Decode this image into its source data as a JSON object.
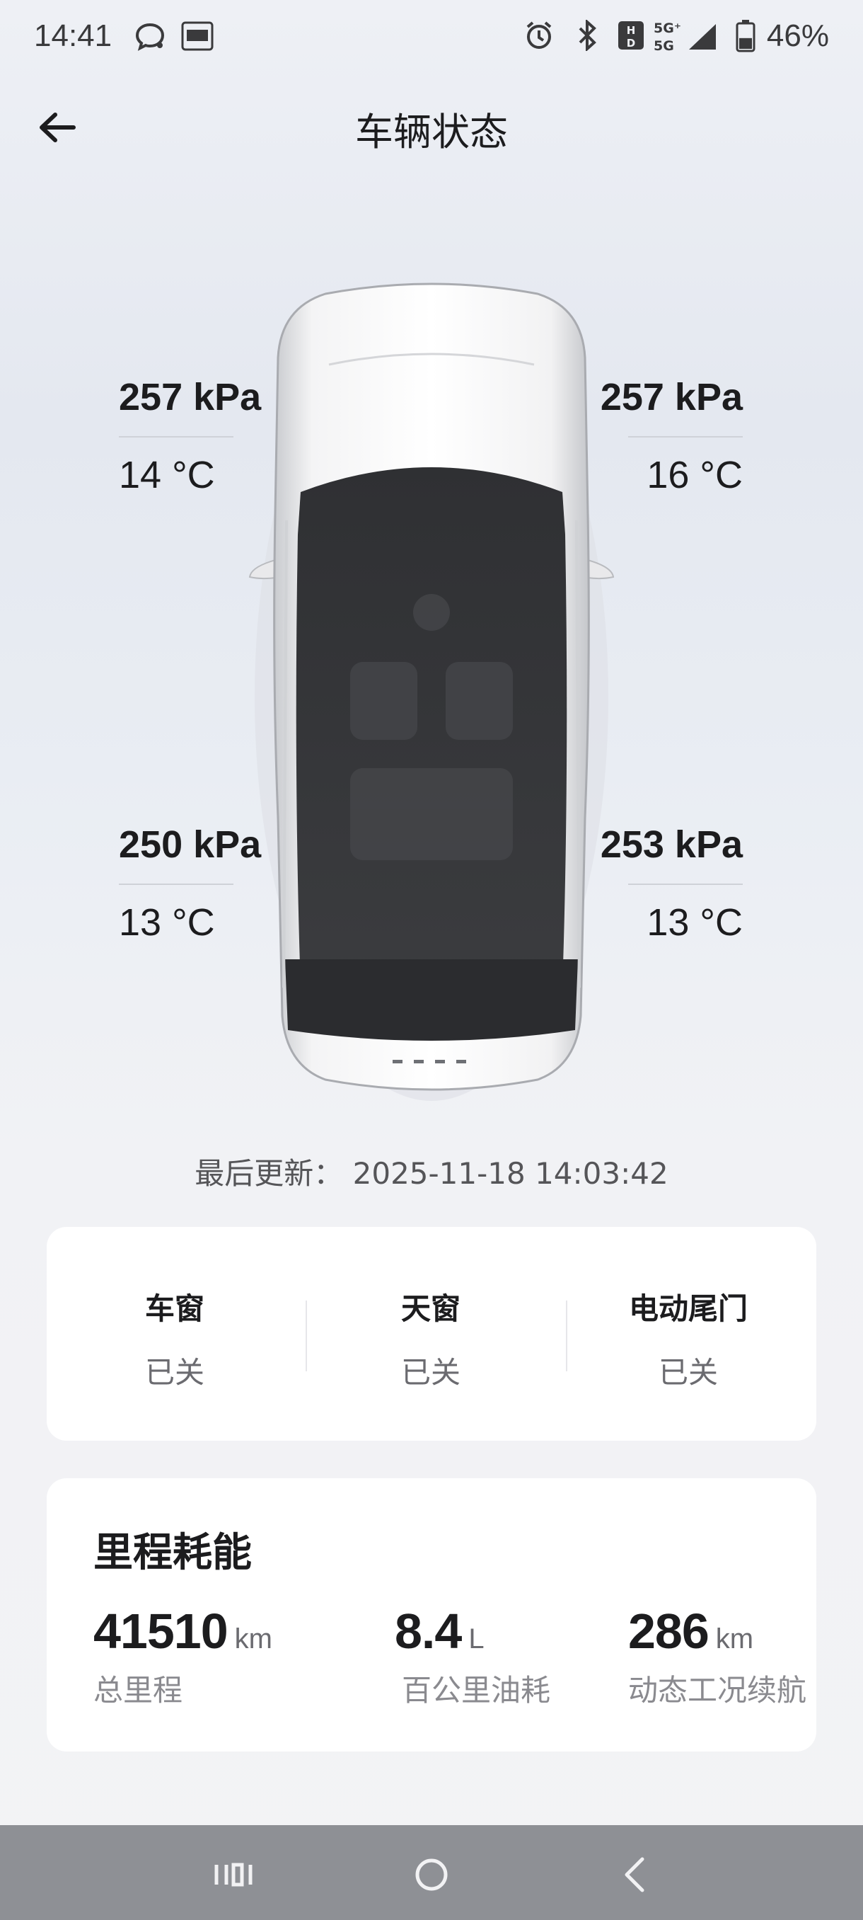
{
  "status_bar": {
    "time": "14:41",
    "left_icons": [
      "chat-bubble-icon",
      "toutiao-app-icon"
    ],
    "right_icons": [
      "alarm-icon",
      "bluetooth-icon",
      "hd-icon",
      "signal-icon",
      "battery-icon"
    ],
    "network": "5G",
    "battery_percent": "46%",
    "battery_level": 0.46
  },
  "header": {
    "title": "车辆状态",
    "back_icon": "arrow-left-icon"
  },
  "tires": {
    "front_left": {
      "pressure": "257 kPa",
      "temperature": "14 °C"
    },
    "front_right": {
      "pressure": "257 kPa",
      "temperature": "16 °C"
    },
    "rear_left": {
      "pressure": "250 kPa",
      "temperature": "13 °C"
    },
    "rear_right": {
      "pressure": "253 kPa",
      "temperature": "13 °C"
    }
  },
  "last_update": {
    "label": "最后更新：",
    "value": "2025-11-18 14:03:42"
  },
  "openings": [
    {
      "label": "车窗",
      "value": "已关"
    },
    {
      "label": "天窗",
      "value": "已关"
    },
    {
      "label": "电动尾门",
      "value": "已关"
    }
  ],
  "energy": {
    "title": "里程耗能",
    "metrics": [
      {
        "value": "41510",
        "unit": "km",
        "caption": "总里程"
      },
      {
        "value": "8.4",
        "unit": "L",
        "caption": "百公里油耗"
      },
      {
        "value": "286",
        "unit": "km",
        "caption": "动态工况续航"
      }
    ]
  },
  "nav": {
    "buttons": [
      "recent-apps-icon",
      "home-icon",
      "back-icon"
    ]
  },
  "colors": {
    "card_bg": "#ffffff",
    "text_primary": "#1c1c1e",
    "text_secondary": "#6b6b70",
    "navbar_bg": "#8e9095"
  }
}
